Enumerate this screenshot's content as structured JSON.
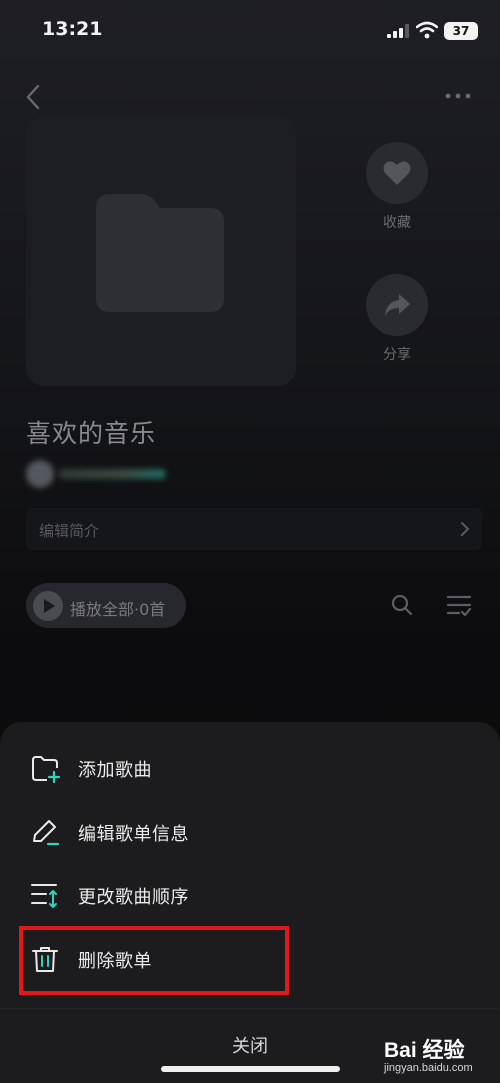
{
  "status_bar": {
    "time": "13:21",
    "battery": "37"
  },
  "playlist": {
    "title": "喜欢的音乐",
    "edit_intro": "编辑简介",
    "play_all": "播放全部·0首"
  },
  "actions": {
    "favorite_label": "收藏",
    "share_label": "分享"
  },
  "sheet": {
    "items": [
      {
        "label": "添加歌曲",
        "icon": "folder-add-icon"
      },
      {
        "label": "编辑歌单信息",
        "icon": "pencil-icon"
      },
      {
        "label": "更改歌曲顺序",
        "icon": "reorder-icon"
      },
      {
        "label": "删除歌单",
        "icon": "trash-icon"
      }
    ],
    "close_label": "关闭"
  },
  "watermark": {
    "logo": "Bai 经验",
    "url": "jingyan.baidu.com"
  },
  "colors": {
    "accent": "#2dd4bf",
    "highlight": "#e01a1a",
    "sheet_bg": "#1c1c1e"
  }
}
